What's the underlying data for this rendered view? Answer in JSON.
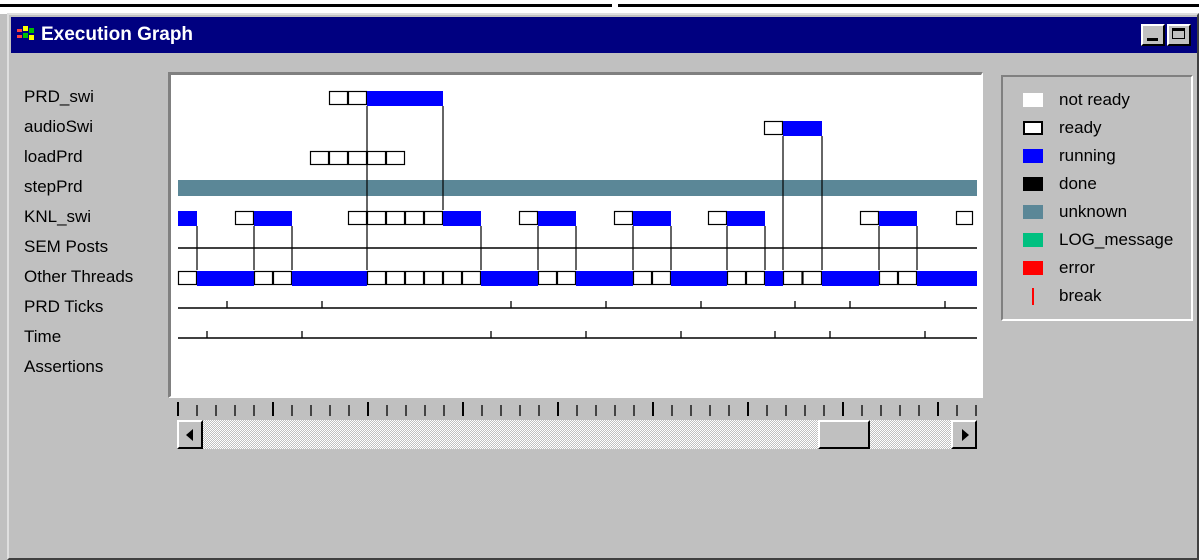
{
  "window": {
    "title": "Execution Graph",
    "app_icon": "execution-graph-app-icon",
    "buttons": [
      "minimize-icon",
      "maximize-icon"
    ]
  },
  "rows": [
    {
      "label": "PRD_swi"
    },
    {
      "label": "audioSwi"
    },
    {
      "label": "loadPrd"
    },
    {
      "label": "stepPrd"
    },
    {
      "label": "KNL_swi"
    },
    {
      "label": "SEM Posts"
    },
    {
      "label": "Other Threads"
    },
    {
      "label": "PRD Ticks"
    },
    {
      "label": "Time"
    },
    {
      "label": "Assertions"
    }
  ],
  "legend": [
    {
      "label": "not ready",
      "color": "#ffffff",
      "style": "fill"
    },
    {
      "label": "ready",
      "color": "#ffffff",
      "style": "outline"
    },
    {
      "label": "running",
      "color": "#0000ff",
      "style": "fill"
    },
    {
      "label": "done",
      "color": "#000000",
      "style": "fill"
    },
    {
      "label": "unknown",
      "color": "#5b8797",
      "style": "fill"
    },
    {
      "label": "LOG_message",
      "color": "#00c080",
      "style": "fill"
    },
    {
      "label": "error",
      "color": "#ff0000",
      "style": "fill"
    },
    {
      "label": "break",
      "color": "#ff0000",
      "style": "line"
    }
  ],
  "colors": {
    "titlebar": "#000080",
    "running": "#0000ff",
    "unknown": "#5b8797",
    "background": "#c0c0c0"
  },
  "scrollbar": {
    "left_button": "scroll-left-arrow-icon",
    "right_button": "scroll-right-arrow-icon",
    "thumb_position": 0.83
  }
}
